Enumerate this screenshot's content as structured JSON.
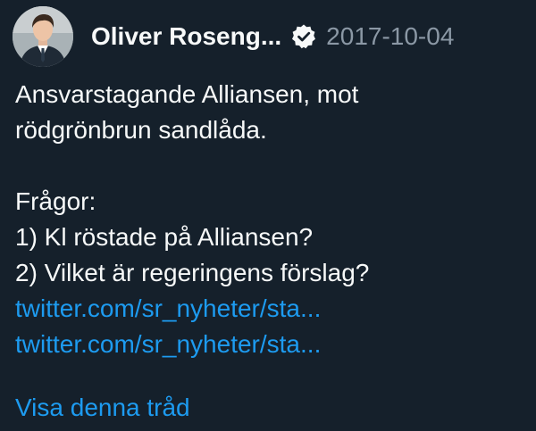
{
  "author": {
    "display_name": "Oliver Roseng...",
    "verified": true,
    "date": "2017-10-04",
    "avatar_icon": "person-avatar-icon",
    "badge_icon": "verified-badge-icon"
  },
  "tweet": {
    "lines": [
      "Ansvarstagande Alliansen, mot",
      "rödgrönbrun sandlåda."
    ],
    "question_lines": [
      "Frågor:",
      "1) Kl röstade på Alliansen?",
      "2) Vilket är regeringens förslag?"
    ],
    "links": [
      "twitter.com/sr_nyheter/sta...",
      "twitter.com/sr_nyheter/sta..."
    ]
  },
  "footer": {
    "show_thread_label": "Visa denna tråd"
  },
  "colors": {
    "background": "#15202b",
    "text": "#f7f9f9",
    "muted": "#8b98a5",
    "link": "#1d9bf0"
  }
}
